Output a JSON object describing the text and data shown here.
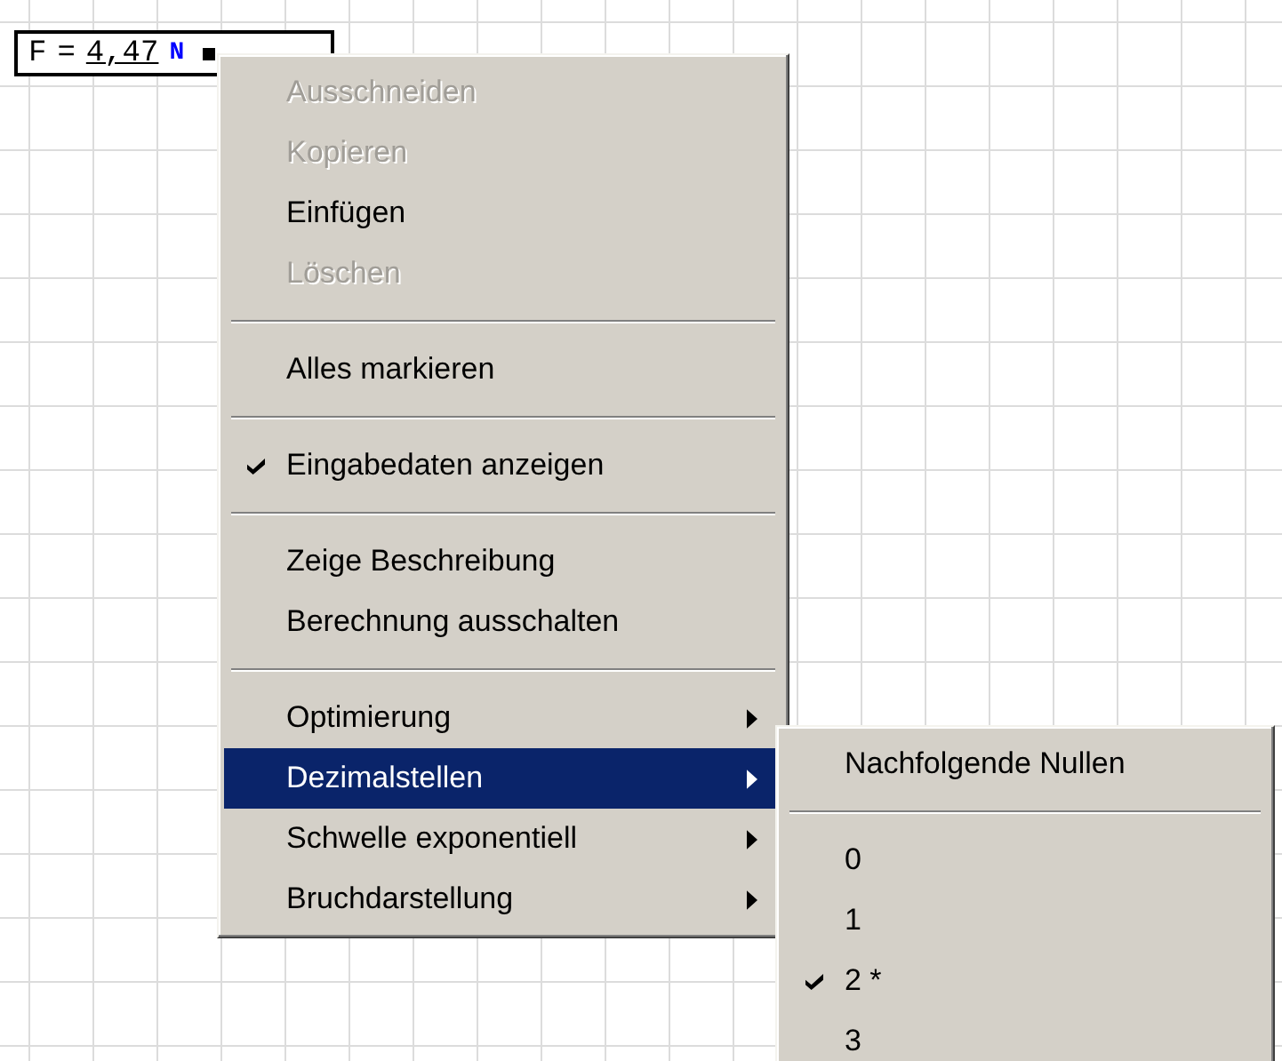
{
  "formula": {
    "variable": "F",
    "equals": "=",
    "value": "4,47",
    "unit": "N"
  },
  "context_menu": {
    "items": [
      {
        "kind": "item",
        "label": "Ausschneiden",
        "disabled": true,
        "checked": false,
        "selected": false,
        "submenu": false
      },
      {
        "kind": "item",
        "label": "Kopieren",
        "disabled": true,
        "checked": false,
        "selected": false,
        "submenu": false
      },
      {
        "kind": "item",
        "label": "Einfügen",
        "disabled": false,
        "checked": false,
        "selected": false,
        "submenu": false
      },
      {
        "kind": "item",
        "label": "Löschen",
        "disabled": true,
        "checked": false,
        "selected": false,
        "submenu": false
      },
      {
        "kind": "separator"
      },
      {
        "kind": "item",
        "label": "Alles markieren",
        "disabled": false,
        "checked": false,
        "selected": false,
        "submenu": false
      },
      {
        "kind": "separator"
      },
      {
        "kind": "item",
        "label": "Eingabedaten anzeigen",
        "disabled": false,
        "checked": true,
        "selected": false,
        "submenu": false
      },
      {
        "kind": "separator"
      },
      {
        "kind": "item",
        "label": "Zeige Beschreibung",
        "disabled": false,
        "checked": false,
        "selected": false,
        "submenu": false
      },
      {
        "kind": "item",
        "label": "Berechnung ausschalten",
        "disabled": false,
        "checked": false,
        "selected": false,
        "submenu": false
      },
      {
        "kind": "separator"
      },
      {
        "kind": "item",
        "label": "Optimierung",
        "disabled": false,
        "checked": false,
        "selected": false,
        "submenu": true
      },
      {
        "kind": "item",
        "label": "Dezimalstellen",
        "disabled": false,
        "checked": false,
        "selected": true,
        "submenu": true
      },
      {
        "kind": "item",
        "label": "Schwelle exponentiell",
        "disabled": false,
        "checked": false,
        "selected": false,
        "submenu": true
      },
      {
        "kind": "item",
        "label": "Bruchdarstellung",
        "disabled": false,
        "checked": false,
        "selected": false,
        "submenu": true
      }
    ]
  },
  "submenu": {
    "items": [
      {
        "kind": "item",
        "label": "Nachfolgende Nullen",
        "disabled": false,
        "checked": false,
        "selected": false,
        "submenu": false
      },
      {
        "kind": "separator"
      },
      {
        "kind": "item",
        "label": "0",
        "disabled": false,
        "checked": false,
        "selected": false,
        "submenu": false
      },
      {
        "kind": "item",
        "label": "1",
        "disabled": false,
        "checked": false,
        "selected": false,
        "submenu": false
      },
      {
        "kind": "item",
        "label": "2 *",
        "disabled": false,
        "checked": true,
        "selected": false,
        "submenu": false
      },
      {
        "kind": "item",
        "label": "3",
        "disabled": false,
        "checked": false,
        "selected": false,
        "submenu": false
      }
    ]
  }
}
